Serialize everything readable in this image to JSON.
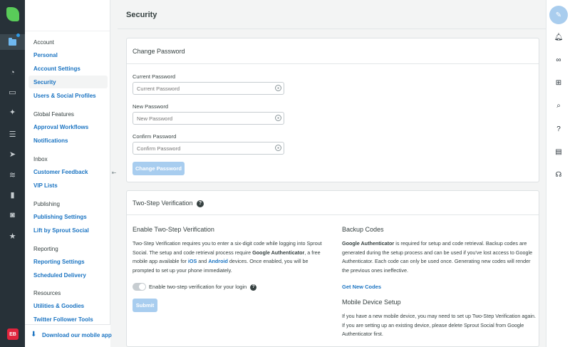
{
  "rail": {
    "avatar_initials": "EB",
    "items": [
      {
        "icon": "folder-icon",
        "active": true
      },
      {
        "icon": "dashboard-icon"
      },
      {
        "icon": "inbox-icon"
      },
      {
        "icon": "pin-icon"
      },
      {
        "icon": "list-icon"
      },
      {
        "icon": "paper-plane-icon"
      },
      {
        "icon": "listening-wave-icon"
      },
      {
        "icon": "bar-chart-icon"
      },
      {
        "icon": "bot-icon"
      },
      {
        "icon": "star-icon"
      }
    ]
  },
  "subnav": {
    "sections": [
      {
        "heading": "Account",
        "links": [
          "Personal",
          "Account Settings",
          "Security",
          "Users & Social Profiles"
        ]
      },
      {
        "heading": "Global Features",
        "links": [
          "Approval Workflows",
          "Notifications"
        ]
      },
      {
        "heading": "Inbox",
        "links": [
          "Customer Feedback",
          "VIP Lists"
        ]
      },
      {
        "heading": "Publishing",
        "links": [
          "Publishing Settings",
          "Lift by Sprout Social"
        ]
      },
      {
        "heading": "Reporting",
        "links": [
          "Reporting Settings",
          "Scheduled Delivery"
        ]
      },
      {
        "heading": "Resources",
        "links": [
          "Utilities & Goodies",
          "Twitter Follower Tools"
        ]
      }
    ],
    "selected": "Security",
    "download": "Download our mobile app"
  },
  "page": {
    "title": "Security"
  },
  "change_password": {
    "heading": "Change Password",
    "current_label": "Current Password",
    "current_placeholder": "Current Password",
    "new_label": "New Password",
    "new_placeholder": "New Password",
    "confirm_label": "Confirm Password",
    "confirm_placeholder": "Confirm Password",
    "button": "Change Password"
  },
  "two_step": {
    "heading": "Two-Step Verification",
    "enable_heading": "Enable Two-Step Verification",
    "enable_p1": "Two-Step Verification requires you to enter a six-digit code while logging into Sprout Social. The setup and code retrieval process require ",
    "enable_bold": "Google Authenticator",
    "enable_p2": ", a free mobile app available for ",
    "enable_ios": "iOS",
    "enable_and": " and ",
    "enable_android": "Android",
    "enable_p3": " devices. Once enabled, you will be prompted to set up your phone immediately.",
    "toggle_label": "Enable two-step verification for your login",
    "submit": "Submit",
    "backup_heading": "Backup Codes",
    "backup_bold": "Google Authenticator",
    "backup_text": " is required for setup and code retrieval. Backup codes are generated during the setup process and can be used if you've lost access to Google Authenticator. Each code can only be used once. Generating new codes will render the previous ones ineffective.",
    "get_codes": "Get New Codes",
    "mobile_heading": "Mobile Device Setup",
    "mobile_text": "If you have a new mobile device, you may need to set up Two-Step Verification again. If you are setting up an existing device, please delete Sprout Social from Google Authenticator first."
  },
  "right_rail": {
    "items": [
      "compose-icon",
      "bell-icon",
      "link-icon",
      "plus-square-icon",
      "search-icon",
      "help-icon",
      "keyboard-icon",
      "headset-icon"
    ]
  }
}
